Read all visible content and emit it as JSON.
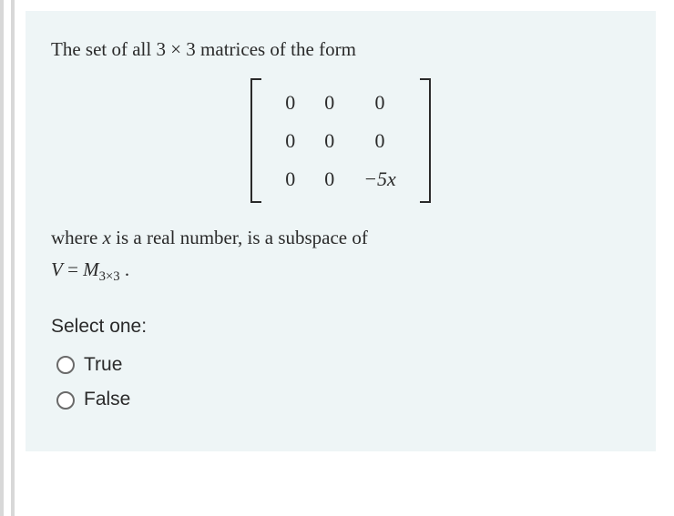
{
  "question": {
    "intro": "The set of all 3 × 3 matrices of the form",
    "matrix": {
      "rows": [
        [
          "0",
          "0",
          "0"
        ],
        [
          "0",
          "0",
          "0"
        ],
        [
          "0",
          "0",
          "−5x"
        ]
      ]
    },
    "condition_line1": "where x is a real number, is a subspace of",
    "condition_line2_prefix": "V = M",
    "condition_line2_sub": "3×3",
    "condition_line2_suffix": " ."
  },
  "prompt": {
    "select_label": "Select one:",
    "options": [
      {
        "label": "True",
        "value": "true"
      },
      {
        "label": "False",
        "value": "false"
      }
    ]
  }
}
